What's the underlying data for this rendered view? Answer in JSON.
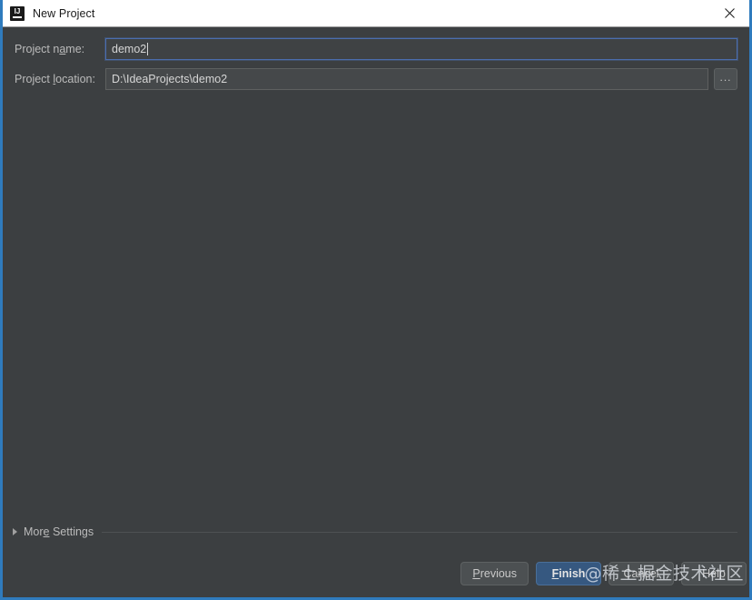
{
  "window": {
    "title": "New Project",
    "logo_icon": "intellij-idea-logo",
    "close_icon": "close-icon",
    "frame_color": "#2f7bbd",
    "titlebar_background": "#ffffff",
    "content_background": "#3c3f41"
  },
  "form": {
    "project_name": {
      "label_before": "Project n",
      "label_mnemonic": "a",
      "label_after": "me:",
      "value": "demo2",
      "placeholder": "",
      "focused": true
    },
    "project_location": {
      "label_before": "Project ",
      "label_mnemonic": "l",
      "label_after": "ocation:",
      "value": "D:\\IdeaProjects\\demo2",
      "placeholder": "",
      "focused": false
    },
    "browse_button": {
      "label": "...",
      "icon": "ellipsis-icon"
    }
  },
  "more_settings": {
    "label_before": "Mor",
    "label_mnemonic": "e",
    "label_after": " Settings",
    "expanded": false,
    "triangle_icon": "chevron-right-icon"
  },
  "buttons": {
    "previous": {
      "label_before": "",
      "label_mnemonic": "P",
      "label_after": "revious"
    },
    "finish": {
      "label_before": "",
      "label_mnemonic": "F",
      "label_after": "inish",
      "is_default": true,
      "accent_color": "#365880"
    },
    "cancel": {
      "label": "Cancel"
    },
    "help": {
      "label": "Help"
    }
  },
  "watermark": {
    "text": "@稀土掘金技术社区"
  }
}
